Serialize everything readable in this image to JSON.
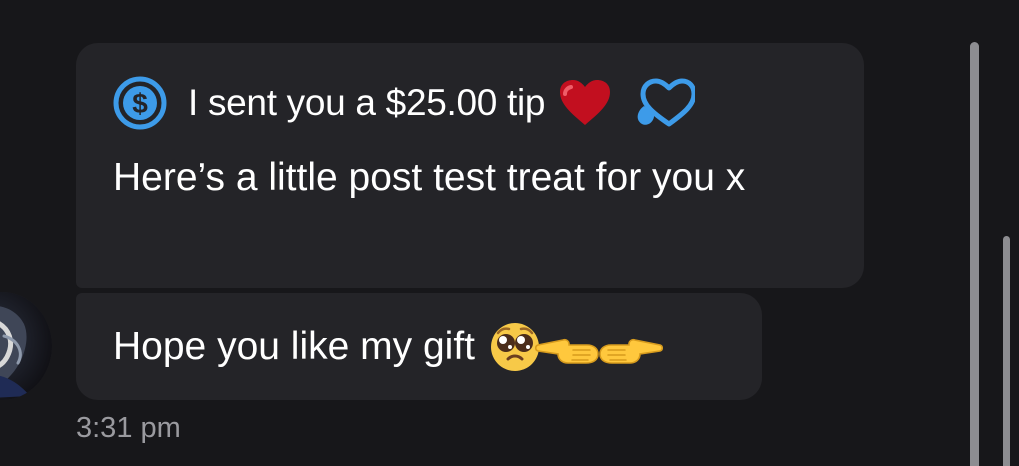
{
  "messages": [
    {
      "tip_text": "I sent you a $25.00 tip",
      "text": "Here’s a little post test treat for you x"
    },
    {
      "text": "Hope you like my gift"
    }
  ],
  "timestamp": "3:31 pm",
  "icons": {
    "tip": "dollar-circle-icon",
    "reaction_red": "red-heart-icon",
    "reaction_outline": "heart-outline-icon",
    "emoji_1": "pleading-face-icon",
    "emoji_2": "point-left-icon",
    "emoji_3": "point-right-icon"
  },
  "colors": {
    "background": "#17171a",
    "bubble": "#242428",
    "text": "#ffffff",
    "accent": "#3d9be9",
    "timestamp": "#9a9a9f",
    "scrollbar": "#8d8d91"
  }
}
